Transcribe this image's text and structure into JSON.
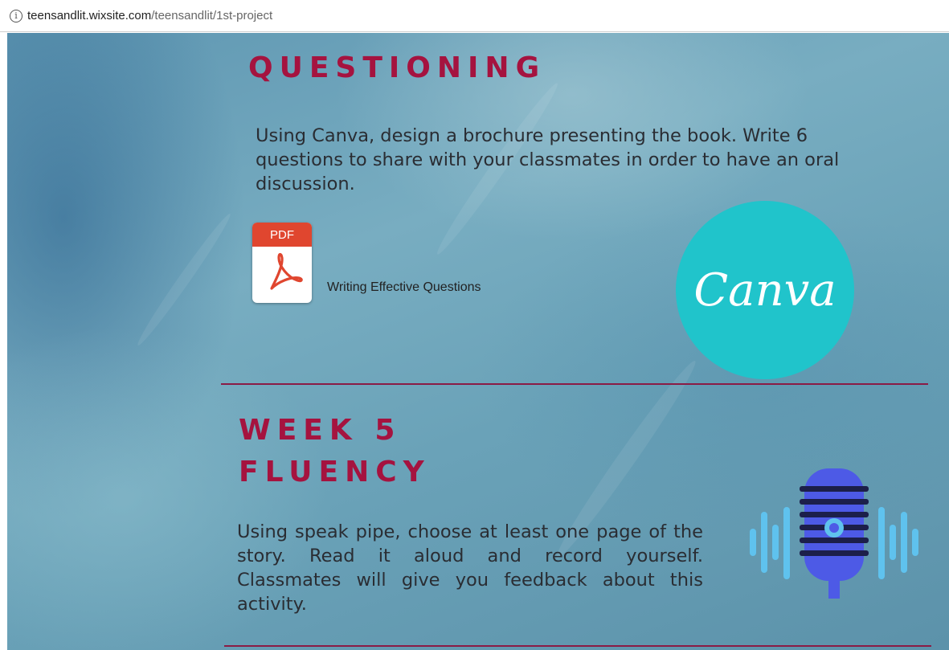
{
  "browser": {
    "url_host": "teensandlit.wixsite.com",
    "url_path": "/teensandlit/1st-project",
    "info_icon": "info-icon"
  },
  "section_questioning": {
    "title": "QUESTIONING",
    "text": "Using Canva, design a brochure presenting the book. Write 6 questions to share with your classmates in order to have an oral discussion.",
    "attachment": {
      "icon": "pdf-icon",
      "badge": "PDF",
      "label": "Writing Effective Questions"
    },
    "logo": {
      "icon": "canva-logo",
      "text": "Canva"
    }
  },
  "section_fluency": {
    "title_line1": "WEEK 5",
    "title_line2": "FLUENCY",
    "text": "Using speak pipe, choose at least one page of the story. Read it aloud and record yourself. Classmates will give you feedback about this activity.",
    "icon": "microphone-icon"
  },
  "colors": {
    "heading": "#a5133f",
    "divider": "#8a1b45",
    "canva": "#20c4cb",
    "pdf_red": "#e0462f"
  }
}
